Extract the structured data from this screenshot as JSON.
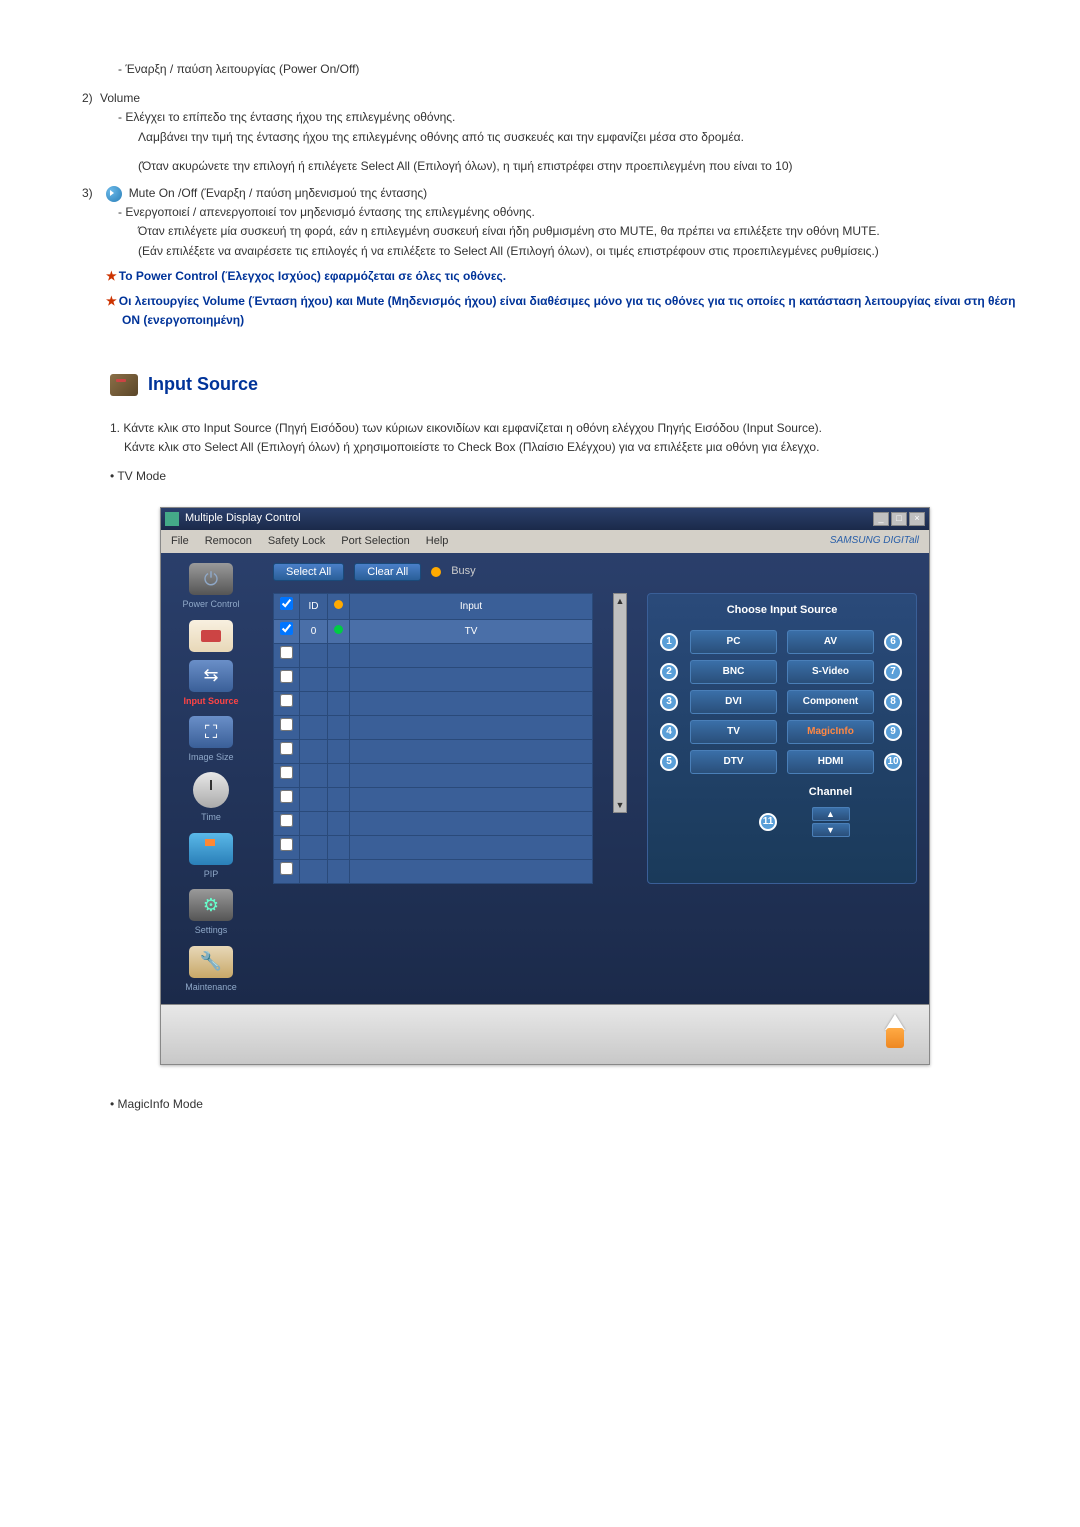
{
  "text": {
    "item1_line": "Έναρξη / παύση λειτουργίας (Power On/Off)",
    "item2_num": "2)",
    "item2_label": "Volume",
    "item2_sub1": "Ελέγχει το επίπεδο της έντασης ήχου της επιλεγμένης οθόνης.",
    "item2_sub2": "Λαμβάνει την τιμή της έντασης ήχου της επιλεγμένης οθόνης από τις συσκευές και την εμφανίζει μέσα στο δρομέα.",
    "item2_sub3": "(Όταν ακυρώνετε την επιλογή ή επιλέγετε Select All (Επιλογή όλων), η τιμή επιστρέφει στην προεπιλεγμένη που είναι το 10)",
    "item3_num": "3)",
    "item3_label": "Mute On /Off (Έναρξη / παύση μηδενισμού της έντασης)",
    "item3_sub1": "Ενεργοποιεί / απενεργοποιεί τον μηδενισμό έντασης της επιλεγμένης οθόνης.",
    "item3_sub2": "Όταν επιλέγετε μία συσκευή τη φορά, εάν η επιλεγμένη συσκευή είναι ήδη ρυθμισμένη στο MUTE, θα πρέπει να επιλέξετε την οθόνη MUTE.",
    "item3_sub3": "(Εάν επιλέξετε να αναιρέσετε τις επιλογές ή να επιλέξετε το Select All (Επιλογή όλων), οι τιμές επιστρέφουν στις προεπιλεγμένες ρυθμίσεις.)",
    "star1": "Το Power Control (Έλεγχος Ισχύος) εφαρμόζεται σε όλες τις οθόνες.",
    "star2": "Οι λειτουργίες Volume (Ένταση ήχου) και Mute (Μηδενισμός ήχου) είναι διαθέσιμες μόνο για τις οθόνες για τις οποίες η κατάσταση λειτουργίας είναι στη θέση ON (ενεργοποιημένη)",
    "section_title": "Input Source",
    "ol_num": "1.",
    "ol_text1": "Κάντε κλικ στο Input Source (Πηγή Εισόδου) των κύριων εικονιδίων και εμφανίζεται η οθόνη ελέγχου Πηγής Εισόδου (Input Source).",
    "ol_text2": "Κάντε κλικ στο Select All (Επιλογή όλων) ή χρησιμοποιείστε το Check Box (Πλαίσιο Ελέγχου) για να επιλέξετε μια οθόνη για έλεγχο.",
    "bullet_tv": "TV Mode",
    "bullet_magic": "MagicInfo Mode"
  },
  "app": {
    "title": "Multiple Display Control",
    "menubar": [
      "File",
      "Remocon",
      "Safety Lock",
      "Port Selection",
      "Help"
    ],
    "brand": "SAMSUNG DIGITall",
    "sidebar": [
      {
        "label": "Power Control",
        "icon": "pc"
      },
      {
        "label": "",
        "icon": "remote"
      },
      {
        "label": "Input Source",
        "icon": "is",
        "active": true
      },
      {
        "label": "Image Size",
        "icon": "is"
      },
      {
        "label": "Time",
        "icon": "time"
      },
      {
        "label": "PIP",
        "icon": "pip"
      },
      {
        "label": "Settings",
        "icon": "settings"
      },
      {
        "label": "Maintenance",
        "icon": "maint"
      }
    ],
    "toolbar": {
      "select_all": "Select All",
      "clear_all": "Clear All",
      "busy": "Busy"
    },
    "grid": {
      "headers": [
        "☑",
        "ID",
        "●",
        "Input"
      ],
      "row1": {
        "id": "0",
        "input": "TV"
      }
    },
    "source_panel": {
      "title": "Choose Input Source",
      "left": [
        "PC",
        "BNC",
        "DVI",
        "TV",
        "DTV"
      ],
      "right": [
        "AV",
        "S-Video",
        "Component",
        "MagicInfo",
        "HDMI"
      ],
      "channel": "Channel"
    }
  }
}
